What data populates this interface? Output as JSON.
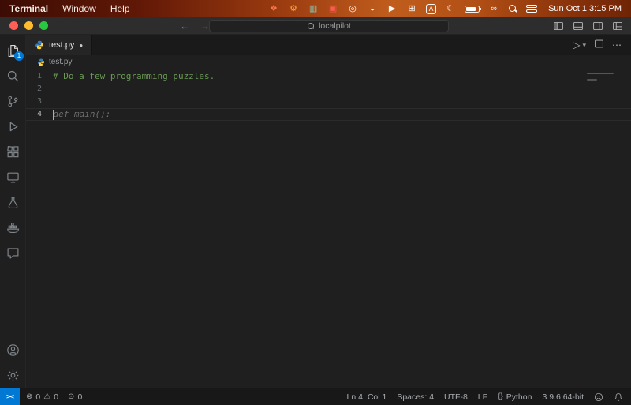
{
  "menu_bar": {
    "menus": [
      {
        "label": "Terminal"
      },
      {
        "label": "Window"
      },
      {
        "label": "Help"
      }
    ],
    "clock": "Sun Oct 1 3:15 PM"
  },
  "glyphs": {
    "app1": "❖",
    "gear": "⚙",
    "stack": "▥",
    "boxed": "▣",
    "record": "◎",
    "users": "◒",
    "play": "▶",
    "grid": "⊞",
    "key_a": "A",
    "moon": "☾",
    "infinity": "∞",
    "back": "←",
    "forward": "→",
    "run": "▷",
    "chevron_down": "▾",
    "ellipsis": "⋯",
    "dot": "●",
    "error": "⊗",
    "warning": "⚠",
    "broadcast": "⊙",
    "remote": "><",
    "braces": "{}"
  },
  "title_bar": {
    "search_text": "localpilot"
  },
  "editor": {
    "tab_label": "test.py",
    "breadcrumb": "test.py",
    "badge_count": "1",
    "lines": [
      {
        "num": "1",
        "code": "# Do a few programming puzzles."
      },
      {
        "num": "2",
        "code": ""
      },
      {
        "num": "3",
        "code": ""
      },
      {
        "num": "4",
        "code": "def main():"
      }
    ]
  },
  "status_bar": {
    "errors": "0",
    "warnings": "0",
    "broadcast_count": "0",
    "cursor_position": "Ln 4, Col 1",
    "indentation": "Spaces: 4",
    "encoding": "UTF-8",
    "eol": "LF",
    "language": "Python",
    "interpreter": "3.9.6 64-bit"
  }
}
